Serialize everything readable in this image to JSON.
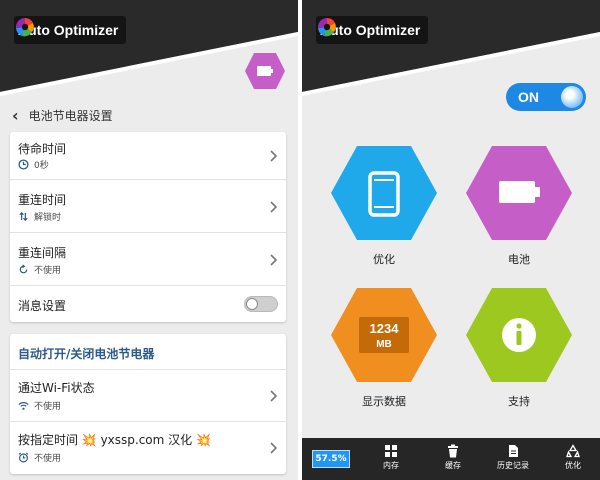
{
  "app": {
    "title": "Auto Optimizer"
  },
  "left": {
    "header_title": "电池节电器设置",
    "card1": [
      {
        "label": "待命时间",
        "value": "0秒",
        "icon": "clock-icon"
      },
      {
        "label": "重连时间",
        "value": "解锁时",
        "icon": "updown-arrows-icon"
      },
      {
        "label": "重连间隔",
        "value": "不使用",
        "icon": "refresh-icon"
      },
      {
        "label": "消息设置"
      }
    ],
    "card2": {
      "section_title": "自动打开/关闭电池节电器",
      "rows": [
        {
          "label": "通过Wi-Fi状态",
          "value": "不使用",
          "icon": "wifi-icon"
        },
        {
          "label": "按指定时间 💥 yxssp.com 汉化 💥",
          "value": "不使用",
          "icon": "alarm-icon"
        }
      ]
    }
  },
  "right": {
    "power_toggle": "ON",
    "items": [
      {
        "label": "优化",
        "color": "#1fa9ea",
        "icon": "phone-icon"
      },
      {
        "label": "电池",
        "color": "#c55fc7",
        "icon": "battery-icon"
      },
      {
        "label": "显示数据",
        "color": "#f08f20",
        "icon": "memory-readout-icon",
        "readout_value": "1234",
        "readout_unit": "MB"
      },
      {
        "label": "支持",
        "color": "#9dc81f",
        "icon": "info-icon"
      }
    ],
    "bottom": {
      "badge": "57.5%",
      "nav": [
        {
          "label": "内存",
          "icon": "grid-icon"
        },
        {
          "label": "缓存",
          "icon": "trash-icon"
        },
        {
          "label": "历史记录",
          "icon": "document-icon"
        },
        {
          "label": "优化",
          "icon": "recycle-icon"
        }
      ]
    }
  },
  "colors": {
    "banner": "#2a2a2a",
    "accent_blue": "#1e88e5",
    "purple": "#c55fc7",
    "section_title": "#2d5a8a"
  }
}
